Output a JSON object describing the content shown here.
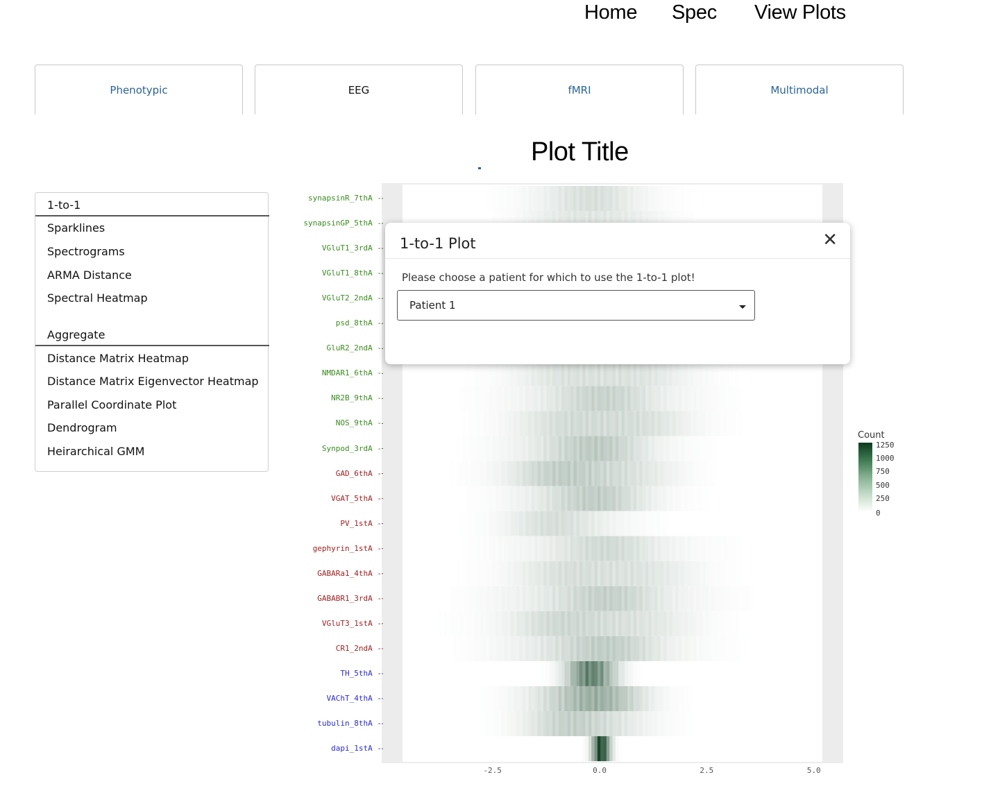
{
  "nav": {
    "links": [
      "Home",
      "Spec",
      "View Plots"
    ]
  },
  "tabs": [
    {
      "label": "Phenotypic",
      "active": false
    },
    {
      "label": "EEG",
      "active": true
    },
    {
      "label": "fMRI",
      "active": false
    },
    {
      "label": "Multimodal",
      "active": false
    }
  ],
  "plot": {
    "title": "Plot Title"
  },
  "menu": {
    "groups": [
      {
        "header": "1-to-1",
        "items": [
          "Sparklines",
          "Spectrograms",
          "ARMA Distance",
          "Spectral Heatmap"
        ]
      },
      {
        "header": "Aggregate",
        "items": [
          "Distance Matrix Heatmap",
          "Distance Matrix Eigenvector Heatmap",
          "Parallel Coordinate Plot",
          "Dendrogram",
          "Heirarchical GMM"
        ]
      }
    ]
  },
  "modal": {
    "title": "1-to-1 Plot",
    "close_glyph": "✕",
    "prompt": "Please choose a patient for which to use the 1-to-1 plot!",
    "selected_patient": "Patient 1"
  },
  "colors": {
    "accent_link": "#2a6496",
    "label_green": "#3a8c1f",
    "label_red": "#a32020",
    "label_blue": "#2b2bcc",
    "heat_high": "#0c3b1f",
    "panel_bg": "#ececec"
  },
  "chart_data": {
    "type": "heatmap",
    "title": "",
    "xlabel": "",
    "ylabel": "",
    "x_ticks": [
      "-2.5",
      "0.0",
      "2.5",
      "5.0"
    ],
    "xlim": [
      -4.6,
      5.2
    ],
    "legend": {
      "title": "Count",
      "ticks": [
        "1250",
        "1000",
        "750",
        "500",
        "250",
        "0"
      ],
      "range": [
        0,
        1300
      ],
      "placement": "right"
    },
    "rows": [
      {
        "label": "synapsinR_7thA",
        "group": "green",
        "center": -0.3,
        "spread": 2.0,
        "peak": 220
      },
      {
        "label": "synapsinGP_5thA",
        "group": "green",
        "center": -0.2,
        "spread": 2.0,
        "peak": 230
      },
      {
        "label": "VGluT1_3rdA",
        "group": "green",
        "center": -0.2,
        "spread": 2.0,
        "peak": 260
      },
      {
        "label": "VGluT1_8thA",
        "group": "green",
        "center": -0.2,
        "spread": 2.0,
        "peak": 260
      },
      {
        "label": "VGluT2_2ndA",
        "group": "green",
        "center": -0.2,
        "spread": 2.0,
        "peak": 250
      },
      {
        "label": "psd_8thA",
        "group": "green",
        "center": -0.2,
        "spread": 2.0,
        "peak": 250
      },
      {
        "label": "GluR2_2ndA",
        "group": "green",
        "center": -0.2,
        "spread": 2.0,
        "peak": 250
      },
      {
        "label": "NMDAR1_6thA",
        "group": "green",
        "center": 0.0,
        "spread": 2.6,
        "peak": 280
      },
      {
        "label": "NR2B_9thA",
        "group": "green",
        "center": 0.0,
        "spread": 2.6,
        "peak": 310
      },
      {
        "label": "NOS_9thA",
        "group": "green",
        "center": 0.0,
        "spread": 2.6,
        "peak": 340
      },
      {
        "label": "Synpod_3rdA",
        "group": "green",
        "center": -0.3,
        "spread": 2.3,
        "peak": 380
      },
      {
        "label": "GAD_6thA",
        "group": "red",
        "center": -0.4,
        "spread": 2.4,
        "peak": 420
      },
      {
        "label": "VGAT_5thA",
        "group": "red",
        "center": -0.3,
        "spread": 2.2,
        "peak": 360
      },
      {
        "label": "PV_1stA",
        "group": "red",
        "center": -0.9,
        "spread": 2.0,
        "peak": 240
      },
      {
        "label": "gephyrin_1stA",
        "group": "red",
        "center": 0.0,
        "spread": 2.6,
        "peak": 260
      },
      {
        "label": "GABARa1_4thA",
        "group": "red",
        "center": 0.0,
        "spread": 2.7,
        "peak": 290
      },
      {
        "label": "GABABR1_3rdA",
        "group": "red",
        "center": 0.0,
        "spread": 2.8,
        "peak": 330
      },
      {
        "label": "VGluT3_1stA",
        "group": "red",
        "center": -0.2,
        "spread": 2.8,
        "peak": 330
      },
      {
        "label": "CR1_2ndA",
        "group": "red",
        "center": -0.1,
        "spread": 2.6,
        "peak": 360
      },
      {
        "label": "TH_5thA",
        "group": "blue",
        "center": -0.2,
        "spread": 0.8,
        "peak": 1100
      },
      {
        "label": "VAChT_4thA",
        "group": "blue",
        "center": -0.3,
        "spread": 1.8,
        "peak": 600
      },
      {
        "label": "tubulin_8thA",
        "group": "blue",
        "center": -0.4,
        "spread": 1.9,
        "peak": 380
      },
      {
        "label": "dapi_1stA",
        "group": "blue",
        "center": 0.0,
        "spread": 0.3,
        "peak": 1300
      }
    ]
  }
}
